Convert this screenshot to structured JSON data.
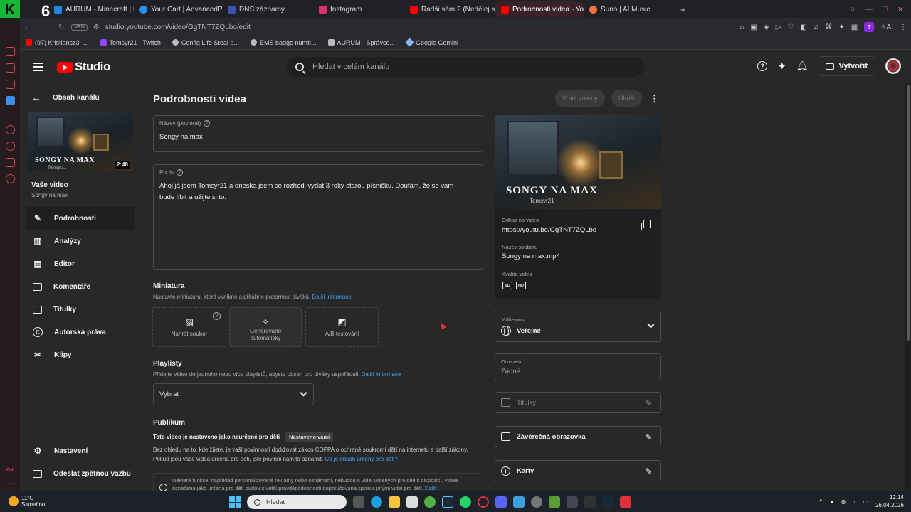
{
  "browser": {
    "tabs": [
      {
        "label": "AURUM - Minecraft | Host",
        "color": "#1e88e5"
      },
      {
        "label": "Your Cart | AdvancedPlug",
        "color": "#2196f3"
      },
      {
        "label": "DNS záznamy",
        "color": "#3f51b5"
      },
      {
        "label": "Instagram",
        "color": "#e1306c"
      },
      {
        "label": "Radši sám 2 (Nedělej ste",
        "color": "#ff0000"
      },
      {
        "label": "Podrobnosti videa - Yo",
        "color": "#ff0000"
      },
      {
        "label": "Suno | AI Music",
        "color": "#ff7043"
      }
    ],
    "url": "studio.youtube.com/video/GgTNT7ZQLbo/edit",
    "vpn_label": "VPN",
    "ai_label": "AI",
    "bookmarks": [
      {
        "label": "(97) Kristiancz3 -...",
        "color": "#ff0000"
      },
      {
        "label": "Tomsyr21 - Twitch",
        "color": "#9146ff"
      },
      {
        "label": "Config Life Steal p...",
        "color": "#bbbbbb"
      },
      {
        "label": "EMS badge numb...",
        "color": "#bbbbbb"
      },
      {
        "label": "AURUM - Správce...",
        "color": "#bbbbbb"
      },
      {
        "label": "Google Gemini",
        "color": "#8ab4f8"
      }
    ],
    "k_badge": "K",
    "six_badge": "6"
  },
  "header": {
    "studio_label": "Studio",
    "search_placeholder": "Hledat v celém kanálu",
    "create_label": "Vytvořit"
  },
  "sidebar": {
    "back_label": "Obsah kanálu",
    "thumb_title": "SONGY NA MAX",
    "thumb_sub": "Tomsyr21",
    "duration": "2:48",
    "your_video": "Vaše video",
    "video_name": "Songy na max",
    "items": [
      {
        "label": "Podrobnosti"
      },
      {
        "label": "Analýzy"
      },
      {
        "label": "Editor"
      },
      {
        "label": "Komentáře"
      },
      {
        "label": "Titulky"
      },
      {
        "label": "Autorská práva"
      },
      {
        "label": "Klipy"
      }
    ],
    "settings": "Nastavení",
    "feedback": "Odeslat zpětnou vazbu"
  },
  "main": {
    "page_title": "Podrobnosti videa",
    "undo_label": "Vrátit změny",
    "save_label": "Uložit",
    "title_label": "Název (povinné)",
    "title_value": "Songy na max",
    "desc_label": "Popis",
    "desc_line1": "Ahoj já jsem Tomsyr21 a dneska jsem se rozhodl vydat 3 roky starou písničku. Doufám, že se vám",
    "desc_line2": "bude líbit a užijte si to.",
    "thumb_section": "Miniatura",
    "thumb_desc": "Nastavte miniaturu, která vynikne a přitáhne pozornost diváků.",
    "more_info": "Další informace",
    "upload_file": "Nahrát soubor",
    "generated_auto": "Generováno automaticky",
    "ab_test": "A/B testování",
    "playlists_title": "Playlisty",
    "playlists_desc": "Přidejte video do jednoho nebo více playlistů, abyste obsah pro diváky uspořádali.",
    "select_label": "Vybrat",
    "audience_title": "Publikum",
    "audience_set": "Toto video je nastaveno jako neurčené pro děti",
    "audience_chip": "Nastaveno vámi",
    "audience_text": "Bez ohledu na to, kde žijete, je vaší povinností dodržovat zákon COPPA o ochraně soukromí dětí na internetu a další zákony. Pokud jsou vaše videa určena pro děti, jste povinni nám to oznámit.",
    "audience_link": "Co je obsah určený pro děti?",
    "notice_text": "Některé funkce, například personalizované reklamy nebo oznámení, nebudou u videí určených pro děti k dispozici. Videa označená jako určená pro děti budou s větší pravděpodobností doporučována spolu s jinými videi pro děti.",
    "notice_link": "Další"
  },
  "right": {
    "preview_title": "SONGY NA MAX",
    "preview_sub": "Tomsyr21",
    "link_label": "Odkaz na video",
    "link_value": "https://youtu.be/GgTNT7ZQLbo",
    "filename_label": "Název souboru",
    "filename_value": "Songy na max.mp4",
    "quality_label": "Kvalita videa",
    "quality_sd": "SD",
    "quality_hd": "HD",
    "visibility_label": "Viditelnost",
    "visibility_value": "Veřejné",
    "restrictions_label": "Omezení",
    "restrictions_value": "Žádné",
    "subtitles": "Titulky",
    "end_screen": "Závěrečná obrazovka",
    "cards": "Karty"
  },
  "taskbar": {
    "temp": "11°C",
    "weather": "Slunečno",
    "search_placeholder": "Hledat",
    "time": "12:14",
    "date": "26.04.2026"
  },
  "colors": {
    "accent_link": "#3ea6ff",
    "youtube_red": "#ff0000",
    "panel": "#282828"
  }
}
